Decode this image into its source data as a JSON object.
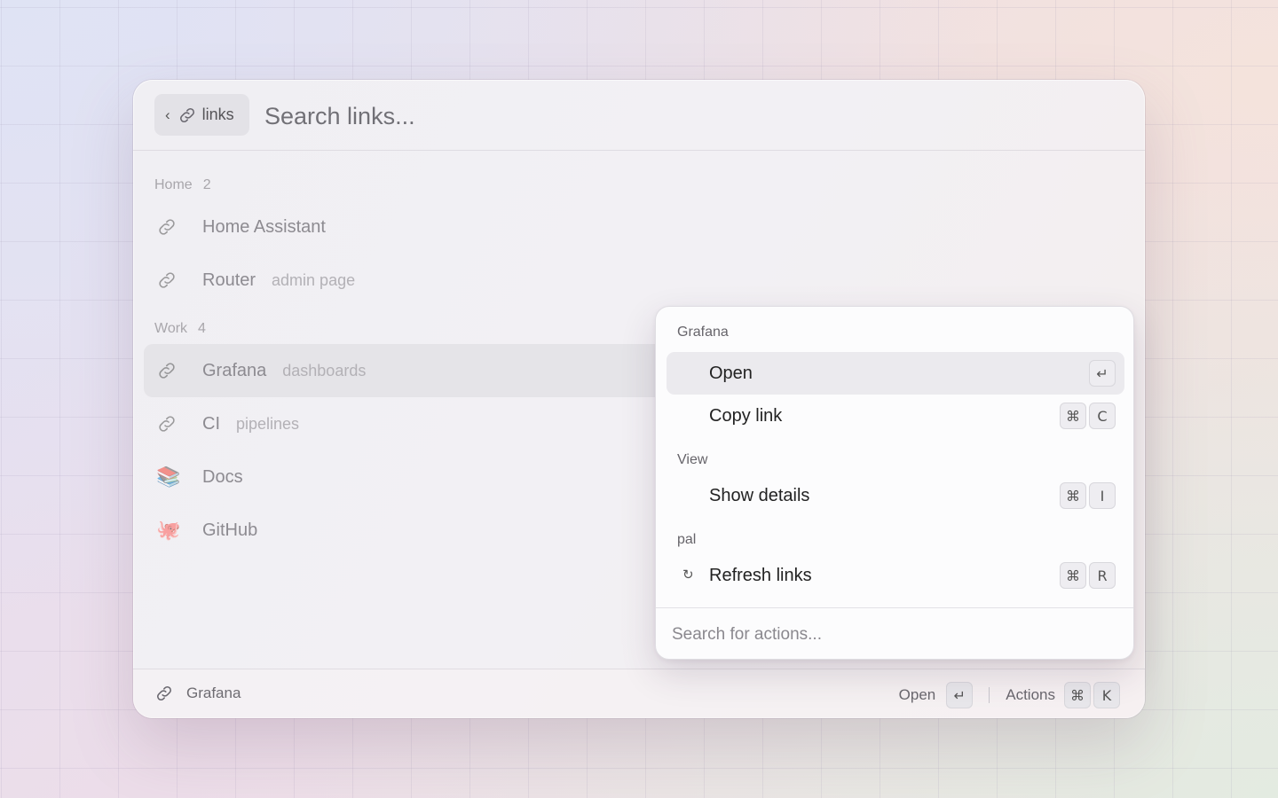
{
  "header": {
    "back_chevron": "‹",
    "crumb_label": "links",
    "search_placeholder": "Search links..."
  },
  "sections": [
    {
      "title": "Home",
      "count": "2"
    },
    {
      "title": "Work",
      "count": "4"
    }
  ],
  "items": [
    {
      "title": "Home Assistant",
      "subtitle": "",
      "icon": "link-icon"
    },
    {
      "title": "Router",
      "subtitle": "admin page",
      "icon": "link-icon"
    },
    {
      "title": "Grafana",
      "subtitle": "dashboards",
      "icon": "link-icon",
      "selected": true
    },
    {
      "title": "CI",
      "subtitle": "pipelines",
      "icon": "link-icon"
    },
    {
      "title": "Docs",
      "subtitle": "",
      "icon": "books-emoji",
      "glyph": "📚"
    },
    {
      "title": "GitHub",
      "subtitle": "",
      "icon": "octopus-emoji",
      "glyph": "🐙"
    }
  ],
  "actions_panel": {
    "sections": [
      {
        "title": "Grafana"
      },
      {
        "title": "View"
      },
      {
        "title": "pal"
      }
    ],
    "actions": [
      {
        "label": "Open",
        "keys": [
          "↵"
        ],
        "selected": true
      },
      {
        "label": "Copy link",
        "keys": [
          "⌘",
          "C"
        ]
      },
      {
        "label": "Show details",
        "keys": [
          "⌘",
          "I"
        ]
      },
      {
        "label": "Refresh links",
        "keys": [
          "⌘",
          "R"
        ],
        "icon": "refresh-icon",
        "glyph": "↻"
      }
    ],
    "search_placeholder": "Search for actions..."
  },
  "footer": {
    "selected_title": "Grafana",
    "primary_action": "Open",
    "primary_key": "↵",
    "actions_label": "Actions",
    "actions_keys": [
      "⌘",
      "K"
    ]
  }
}
